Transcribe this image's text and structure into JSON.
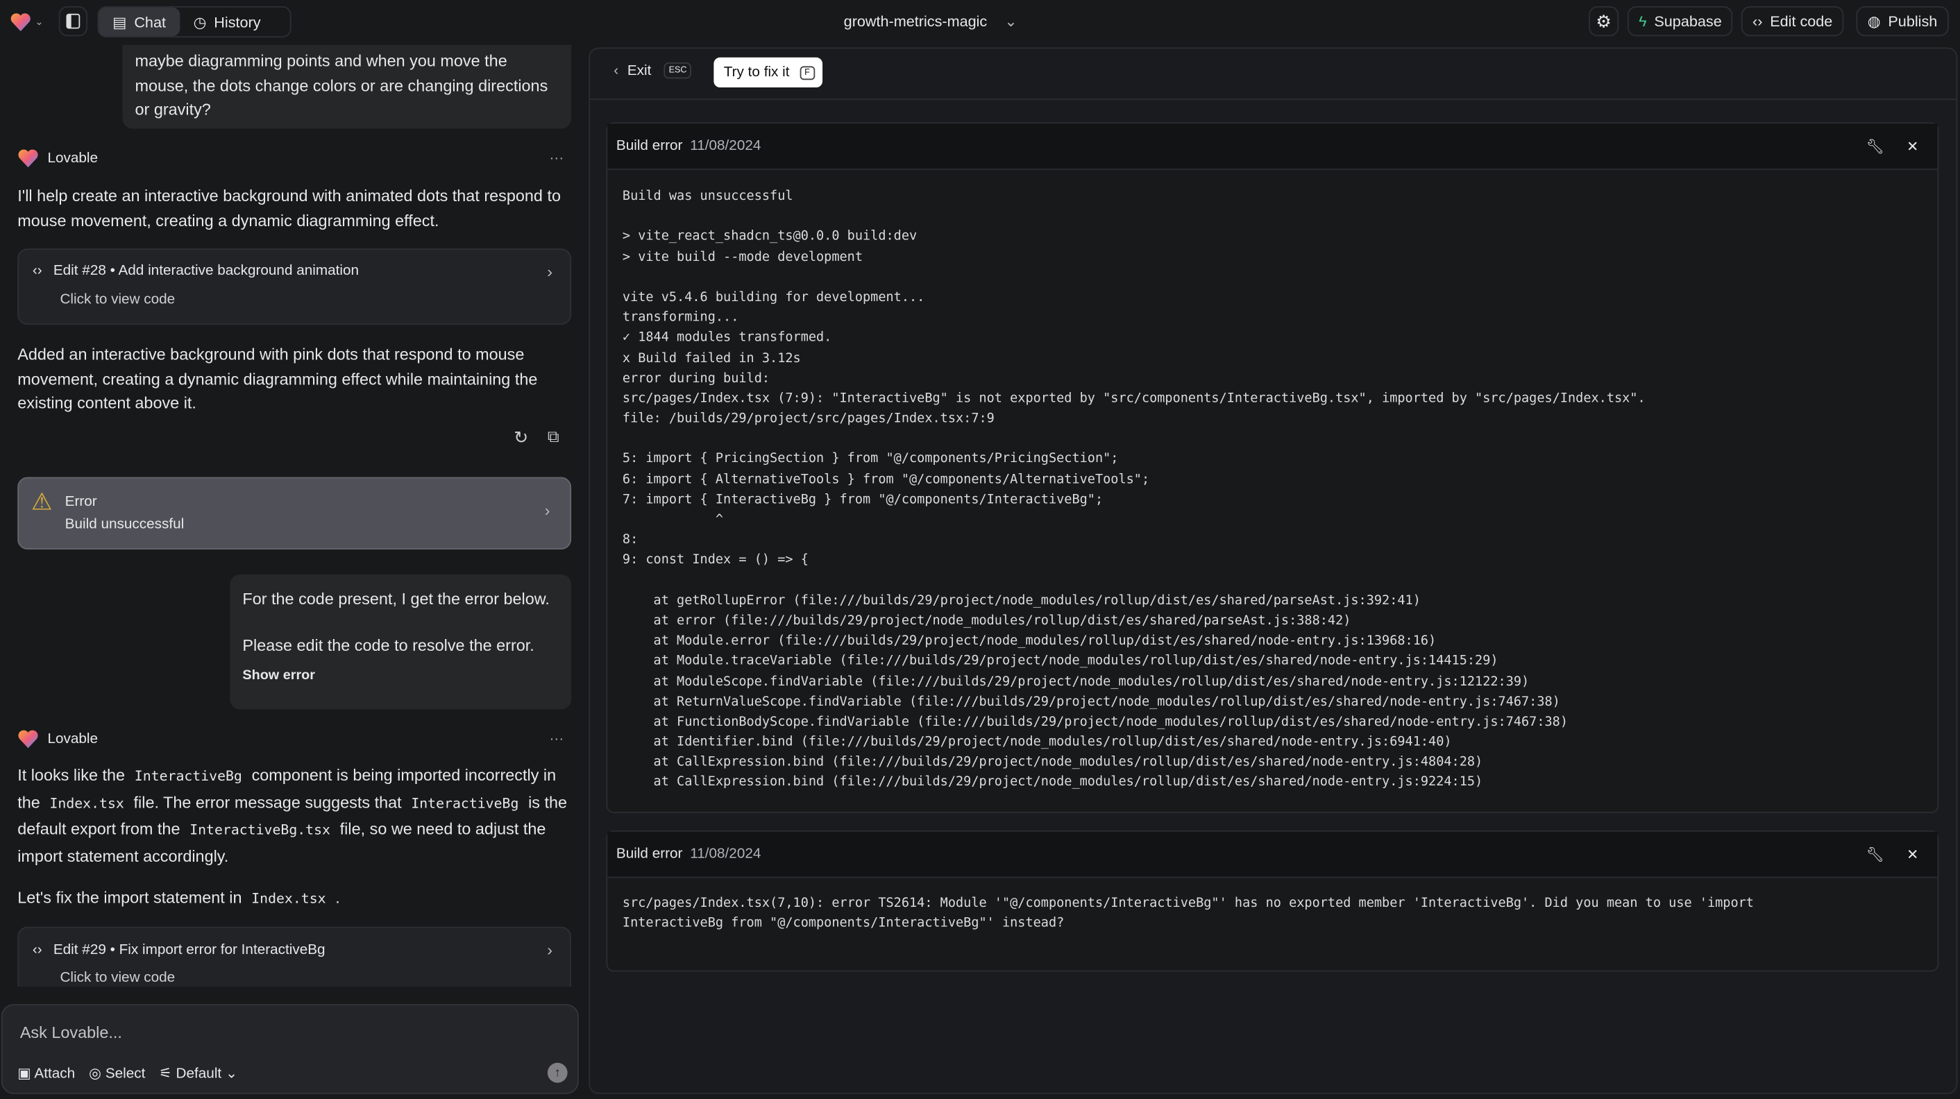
{
  "topbar": {
    "chat_tab": "Chat",
    "history_tab": "History",
    "project_name": "growth-metrics-magic",
    "supabase": "Supabase",
    "edit_code": "Edit code",
    "publish": "Publish"
  },
  "chat": {
    "user_msg_1": "maybe diagramming points and when you move the mouse, the dots change colors or are changing directions or gravity?",
    "assistant_name": "Lovable",
    "reply_1": "I'll help create an interactive background with animated dots that respond to mouse movement, creating a dynamic diagramming effect.",
    "edit_28": {
      "title": "Edit #28 • Add interactive background animation",
      "sub": "Click to view code"
    },
    "reply_1b": "Added an interactive background with pink dots that respond to mouse movement, creating a dynamic diagramming effect while maintaining the existing content above it.",
    "error_card": {
      "title": "Error",
      "sub": "Build unsuccessful"
    },
    "user_msg_2a": "For the code present, I get the error below.",
    "user_msg_2b": "Please edit the code to resolve the error.",
    "show_error": "Show error",
    "reply_2": {
      "p1": "It looks like the ",
      "c1": "InteractiveBg",
      "p2": " component is being imported incorrectly in the ",
      "c2": "Index.tsx",
      "p3": " file. The error message suggests that ",
      "c3": "InteractiveBg",
      "p4": " is the default export from the ",
      "c4": "InteractiveBg.tsx",
      "p5": " file, so we need to adjust the import statement accordingly."
    },
    "reply_3": {
      "p1": "Let's fix the import statement in ",
      "c1": "Index.tsx",
      "p2": " ."
    },
    "edit_29": {
      "title": "Edit #29 • Fix import error for InteractiveBg",
      "sub": "Click to view code"
    },
    "input_placeholder": "Ask Lovable...",
    "attach": "Attach",
    "select": "Select",
    "mode": "Default"
  },
  "panel": {
    "exit": "Exit",
    "exit_key": "ESC",
    "fix": "Try to fix it",
    "fix_key": "F",
    "errors": [
      {
        "title": "Build error",
        "date": "11/08/2024",
        "lines": [
          "Build was unsuccessful",
          "",
          "> vite_react_shadcn_ts@0.0.0 build:dev",
          "> vite build --mode development",
          "",
          "vite v5.4.6 building for development...",
          "transforming...",
          "✓ 1844 modules transformed.",
          "x Build failed in 3.12s",
          "error during build:",
          "src/pages/Index.tsx (7:9): \"InteractiveBg\" is not exported by \"src/components/InteractiveBg.tsx\", imported by \"src/pages/Index.tsx\".",
          "file: /builds/29/project/src/pages/Index.tsx:7:9",
          "",
          "5: import { PricingSection } from \"@/components/PricingSection\";",
          "6: import { AlternativeTools } from \"@/components/AlternativeTools\";",
          "7: import { InteractiveBg } from \"@/components/InteractiveBg\";",
          "            ^",
          "8:",
          "9: const Index = () => {",
          "",
          "    at getRollupError (file:///builds/29/project/node_modules/rollup/dist/es/shared/parseAst.js:392:41)",
          "    at error (file:///builds/29/project/node_modules/rollup/dist/es/shared/parseAst.js:388:42)",
          "    at Module.error (file:///builds/29/project/node_modules/rollup/dist/es/shared/node-entry.js:13968:16)",
          "    at Module.traceVariable (file:///builds/29/project/node_modules/rollup/dist/es/shared/node-entry.js:14415:29)",
          "    at ModuleScope.findVariable (file:///builds/29/project/node_modules/rollup/dist/es/shared/node-entry.js:12122:39)",
          "    at ReturnValueScope.findVariable (file:///builds/29/project/node_modules/rollup/dist/es/shared/node-entry.js:7467:38)",
          "    at FunctionBodyScope.findVariable (file:///builds/29/project/node_modules/rollup/dist/es/shared/node-entry.js:7467:38)",
          "    at Identifier.bind (file:///builds/29/project/node_modules/rollup/dist/es/shared/node-entry.js:6941:40)",
          "    at CallExpression.bind (file:///builds/29/project/node_modules/rollup/dist/es/shared/node-entry.js:4804:28)",
          "    at CallExpression.bind (file:///builds/29/project/node_modules/rollup/dist/es/shared/node-entry.js:9224:15)"
        ]
      },
      {
        "title": "Build error",
        "date": "11/08/2024",
        "lines": [
          "src/pages/Index.tsx(7,10): error TS2614: Module '\"@/components/InteractiveBg\"' has no exported member 'InteractiveBg'. Did you mean to use 'import",
          "InteractiveBg from \"@/components/InteractiveBg\"' instead?"
        ]
      }
    ]
  },
  "colors": {
    "background": "#18191b",
    "supabase_green": "#3ecf8e",
    "warning": "#e0b03a",
    "error_card": "#505158"
  }
}
